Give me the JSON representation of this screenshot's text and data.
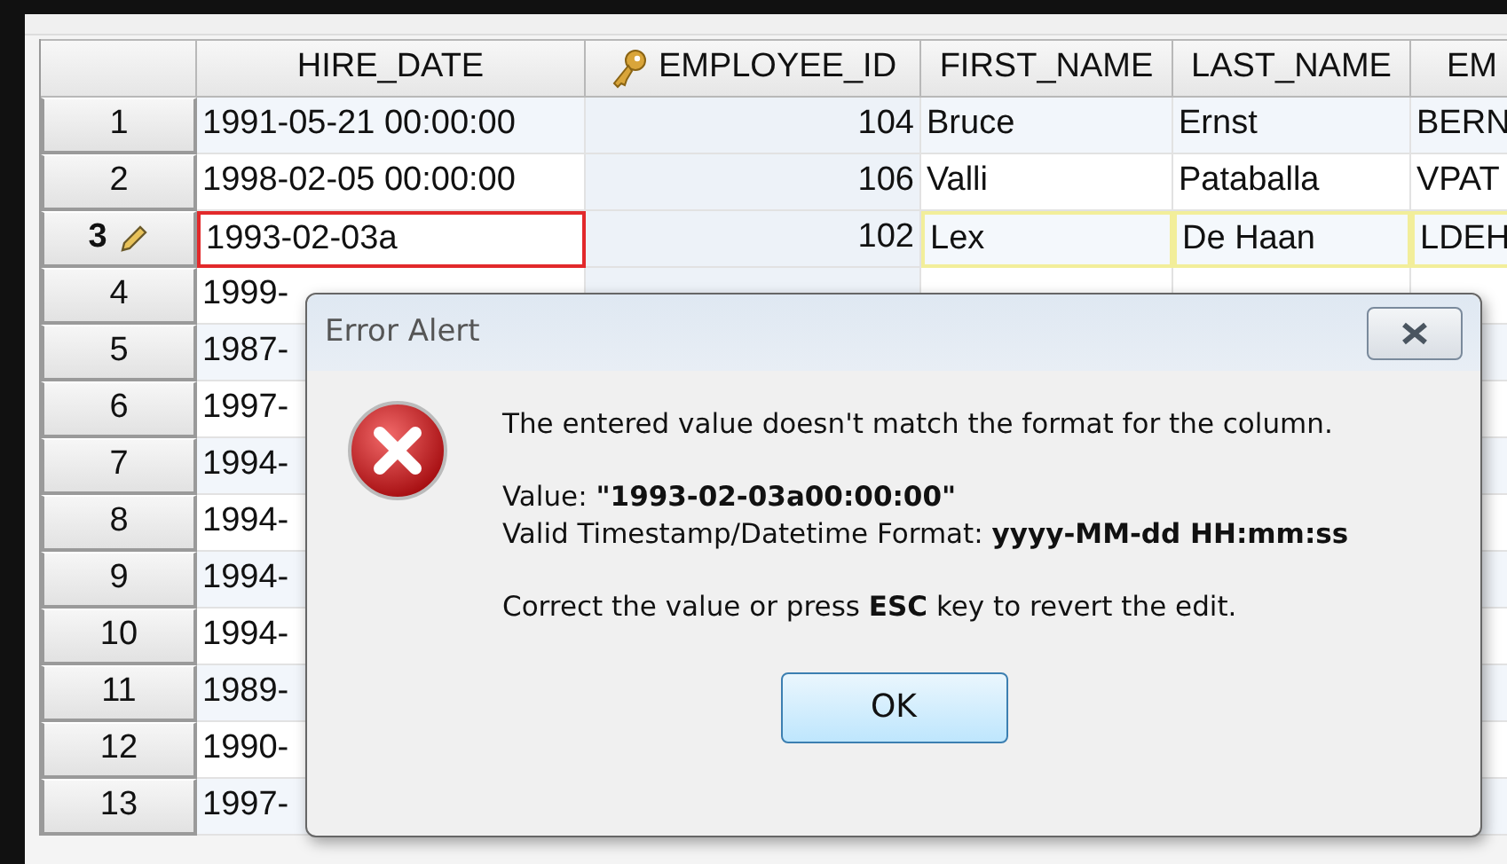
{
  "table": {
    "columns": [
      {
        "label": "HIRE_DATE",
        "key_icon": false
      },
      {
        "label": "EMPLOYEE_ID",
        "key_icon": true
      },
      {
        "label": "FIRST_NAME",
        "key_icon": false
      },
      {
        "label": "LAST_NAME",
        "key_icon": false
      },
      {
        "label": "EM",
        "key_icon": false
      }
    ],
    "rows": [
      {
        "number": "1",
        "selected": false,
        "editing": false,
        "cells": [
          "1991-05-21 00:00:00",
          "104",
          "Bruce",
          "Ernst",
          "BERN"
        ]
      },
      {
        "number": "2",
        "selected": false,
        "editing": false,
        "cells": [
          "1998-02-05 00:00:00",
          "106",
          "Valli",
          "Pataballa",
          "VPAT"
        ]
      },
      {
        "number": "3",
        "selected": true,
        "editing": true,
        "cells": [
          "1993-02-03a",
          "102",
          "Lex",
          "De Haan",
          "LDEH"
        ]
      },
      {
        "number": "4",
        "selected": false,
        "editing": false,
        "cells": [
          "1999-"
        ]
      },
      {
        "number": "5",
        "selected": false,
        "editing": false,
        "cells": [
          "1987-"
        ]
      },
      {
        "number": "6",
        "selected": false,
        "editing": false,
        "cells": [
          "1997-"
        ]
      },
      {
        "number": "7",
        "selected": false,
        "editing": false,
        "cells": [
          "1994-"
        ]
      },
      {
        "number": "8",
        "selected": false,
        "editing": false,
        "cells": [
          "1994-"
        ]
      },
      {
        "number": "9",
        "selected": false,
        "editing": false,
        "cells": [
          "1994-"
        ]
      },
      {
        "number": "10",
        "selected": false,
        "editing": false,
        "cells": [
          "1994-"
        ]
      },
      {
        "number": "11",
        "selected": false,
        "editing": false,
        "cells": [
          "1989-"
        ]
      },
      {
        "number": "12",
        "selected": false,
        "editing": false,
        "cells": [
          "1990-"
        ]
      },
      {
        "number": "13",
        "selected": false,
        "editing": false,
        "cells": [
          "1997-"
        ]
      }
    ]
  },
  "dialog": {
    "title": "Error Alert",
    "message": "The entered value doesn't match the format for the column.",
    "value_line": "Value: **\"1993-02-03a00:00:00\"**",
    "format_line": "Valid Timestamp/Datetime Format: **yyyy-MM-dd HH:mm:ss**",
    "hint": "Correct the value or press **ESC** key to revert the edit.",
    "ok_button": "OK"
  }
}
